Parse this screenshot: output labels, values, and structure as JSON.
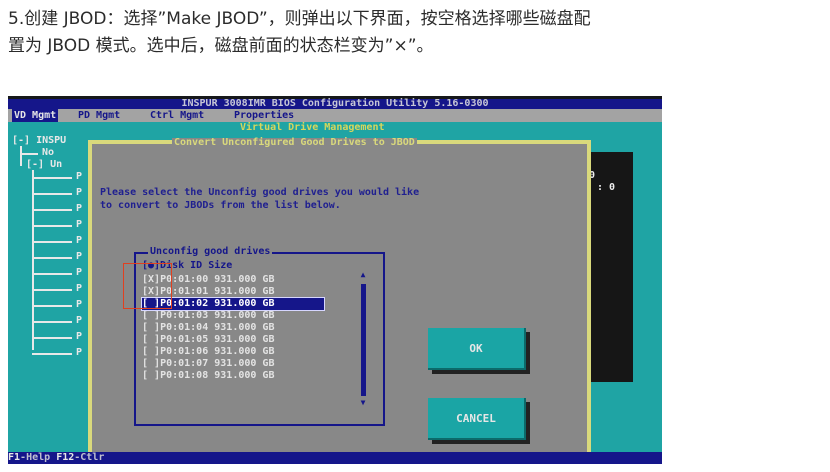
{
  "doc": {
    "line1": "5.创建 JBOD：选择”Make JBOD”，则弹出以下界面，按空格选择哪些磁盘配",
    "line2": "置为 JBOD 模式。选中后，磁盘前面的状态栏变为”×”。"
  },
  "bios": {
    "title": "INSPUR 3008IMR BIOS Configuration Utility 5.16-0300",
    "menu": [
      "VD Mgmt",
      "PD Mgmt",
      "Ctrl Mgmt",
      "Properties"
    ],
    "section_title": "Virtual Drive Management",
    "tree": [
      "[-] INSPU",
      "No",
      "[-] Un",
      "P",
      "P",
      "P",
      "P",
      "P",
      "P",
      "P",
      "P",
      "P",
      "P",
      "P",
      "P"
    ],
    "right_pane": [
      "0",
      ": 0"
    ],
    "dialog": {
      "title": "Convert Unconfigured Good Drives to JBOD",
      "message_line1": "Please select the Unconfig good drives you would like",
      "message_line2": "to convert to JBODs from the list below.",
      "list_title": "Unconfig good drives",
      "list_header": "[●]Disk ID    Size",
      "drives": [
        {
          "mark": "[X]",
          "id": "P0:01:00",
          "size": "931.000 GB"
        },
        {
          "mark": "[X]",
          "id": "P0:01:01",
          "size": "931.000 GB"
        },
        {
          "mark": "[ ]",
          "id": "P0:01:02",
          "size": "931.000 GB",
          "selected": true
        },
        {
          "mark": "[ ]",
          "id": "P0:01:03",
          "size": "931.000 GB"
        },
        {
          "mark": "[ ]",
          "id": "P0:01:04",
          "size": "931.000 GB"
        },
        {
          "mark": "[ ]",
          "id": "P0:01:05",
          "size": "931.000 GB"
        },
        {
          "mark": "[ ]",
          "id": "P0:01:06",
          "size": "931.000 GB"
        },
        {
          "mark": "[ ]",
          "id": "P0:01:07",
          "size": "931.000 GB"
        },
        {
          "mark": "[ ]",
          "id": "P0:01:08",
          "size": "931.000 GB"
        }
      ],
      "ok_label": "OK",
      "cancel_label": "CANCEL"
    },
    "status": {
      "f1": "F1",
      "f1_text": "-Help",
      "f12": "F12",
      "f12_text": "-Ctlr"
    }
  },
  "colors": {
    "bios_blue": "#15168a",
    "bios_teal": "#1fa4a4",
    "dialog_grey": "#888888",
    "highlight_red": "#e04020"
  }
}
